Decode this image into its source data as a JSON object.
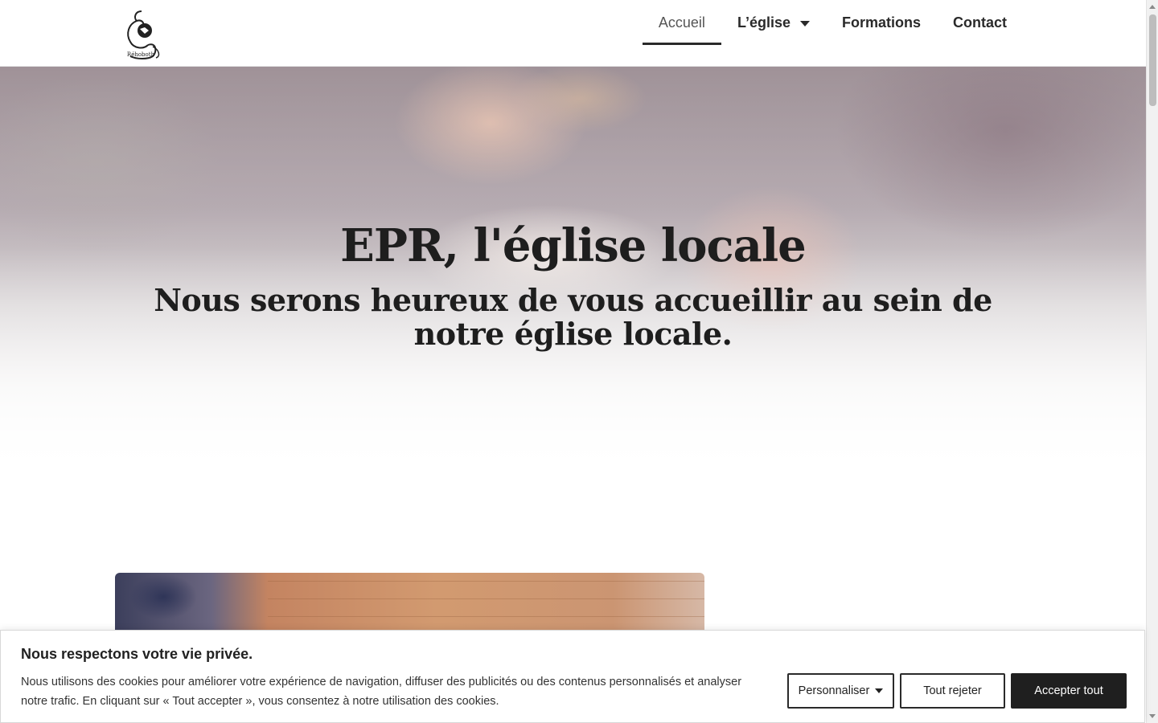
{
  "header": {
    "logo_text": "Réhoboth",
    "nav": [
      {
        "label": "Accueil",
        "active": true
      },
      {
        "label": "L’église",
        "has_dropdown": true
      },
      {
        "label": "Formations"
      },
      {
        "label": "Contact"
      }
    ]
  },
  "hero": {
    "title": "EPR, l'église locale",
    "subtitle": "Nous serons heureux de vous accueillir au sein de notre église locale."
  },
  "cookie_banner": {
    "title": "Nous respectons votre vie privée.",
    "text": "Nous utilisons des cookies pour améliorer votre expérience de navigation, diffuser des publicités ou des contenus personnalisés et analyser notre trafic. En cliquant sur « Tout accepter », vous consentez à notre utilisation des cookies.",
    "buttons": {
      "customize": "Personnaliser",
      "reject": "Tout rejeter",
      "accept": "Accepter tout"
    }
  },
  "colors": {
    "text_dark": "#1e1e1e",
    "accent_dark": "#1f1f1f",
    "hero_tint": "#8f7f86"
  }
}
